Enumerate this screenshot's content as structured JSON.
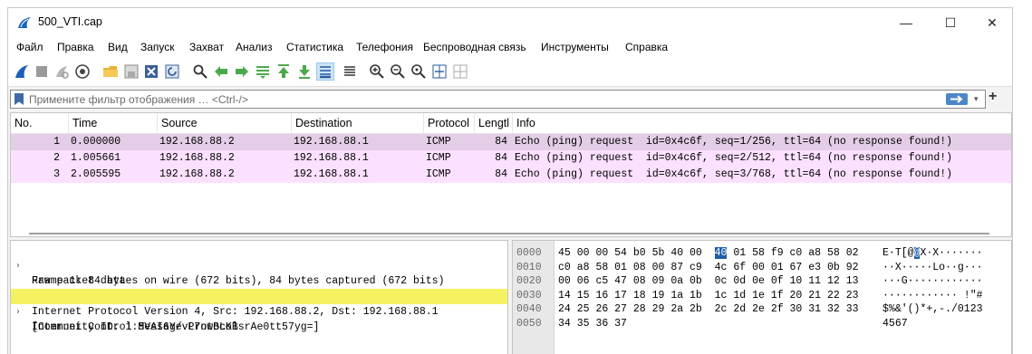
{
  "window": {
    "title": "500_VTI.cap",
    "minimize_glyph": "—",
    "maximize_glyph": "☐",
    "close_glyph": "✕"
  },
  "menu": [
    "Файл",
    "Правка",
    "Вид",
    "Запуск",
    "Захват",
    "Анализ",
    "Статистика",
    "Телефония",
    "Беспроводная связь",
    "Инструменты",
    "Справка"
  ],
  "toolbar": {
    "icons": [
      "shark-fin-start-icon",
      "stop-icon",
      "restart-icon",
      "capture-options-icon",
      "open-folder-icon",
      "save-file-icon",
      "close-file-icon",
      "reload-icon",
      "find-icon",
      "go-back-icon",
      "go-forward-icon",
      "go-to-packet-icon",
      "first-packet-icon",
      "last-packet-icon",
      "autoscroll-icon",
      "colorize-icon",
      "zoom-in-icon",
      "zoom-out-icon",
      "zoom-reset-icon",
      "resize-columns-icon",
      "layout-grid-icon"
    ],
    "active": [
      "autoscroll-icon"
    ]
  },
  "filter": {
    "placeholder": "Примените фильтр отображения … <Ctrl-/>",
    "value": "",
    "dropdown_glyph": "▾",
    "add_glyph": "+"
  },
  "packet_list": {
    "columns": [
      "No.",
      "Time",
      "Source",
      "Destination",
      "Protocol",
      "Lengtl",
      "Info"
    ],
    "rows": [
      {
        "no": "1",
        "time": "0.000000",
        "source": "192.168.88.2",
        "destination": "192.168.88.1",
        "protocol": "ICMP",
        "length": "84",
        "info": "Echo (ping) request  id=0x4c6f, seq=1/256, ttl=64 (no response found!)",
        "selected": true
      },
      {
        "no": "2",
        "time": "1.005661",
        "source": "192.168.88.2",
        "destination": "192.168.88.1",
        "protocol": "ICMP",
        "length": "84",
        "info": "Echo (ping) request  id=0x4c6f, seq=2/512, ttl=64 (no response found!)",
        "selected": false
      },
      {
        "no": "3",
        "time": "2.005595",
        "source": "192.168.88.2",
        "destination": "192.168.88.1",
        "protocol": "ICMP",
        "length": "84",
        "info": "Echo (ping) request  id=0x4c6f, seq=3/768, ttl=64 (no response found!)",
        "selected": false
      }
    ],
    "row_color": "#fce0ff",
    "selected_row_color": "#e4cde6"
  },
  "details": {
    "lines": [
      {
        "text": "Frame 1: 84 bytes on wire (672 bits), 84 bytes captured (672 bits)",
        "expandable": true,
        "highlighted": false
      },
      {
        "text": "Raw packet data",
        "expandable": false,
        "highlighted": false
      },
      {
        "text": "Internet Protocol Version 4, Src: 192.168.88.2, Dst: 192.168.88.1",
        "expandable": true,
        "highlighted": false
      },
      {
        "text": "Internet Control Message Protocol",
        "expandable": true,
        "highlighted": true
      },
      {
        "text": "[Community ID: 1:5VAI6Y/vL7nwBLKBsrAe0tt57yg=]",
        "expandable": false,
        "highlighted": false
      }
    ],
    "expand_glyph": "›",
    "highlight_color": "#f5f261"
  },
  "bytes": {
    "lines": [
      {
        "offset": "0000",
        "hex": [
          "45",
          "00",
          "00",
          "54",
          "b0",
          "5b",
          "40",
          "00",
          "40",
          "01",
          "58",
          "f9",
          "c0",
          "a8",
          "58",
          "02"
        ],
        "ascii": [
          "E",
          "·",
          "T",
          "[",
          "@",
          "@",
          "X",
          "·",
          "X",
          "·",
          "·",
          "·",
          "·",
          "·",
          "·",
          "·"
        ]
      },
      {
        "offset": "0010",
        "hex": [
          "c0",
          "a8",
          "58",
          "01",
          "08",
          "00",
          "87",
          "c9",
          "4c",
          "6f",
          "00",
          "01",
          "67",
          "e3",
          "0b",
          "92"
        ],
        "ascii": [
          "·",
          "·",
          "X",
          "·",
          "·",
          "·",
          "·",
          "·",
          "L",
          "o",
          "·",
          "·",
          "g",
          "·",
          "·",
          "·"
        ]
      },
      {
        "offset": "0020",
        "hex": [
          "00",
          "06",
          "c5",
          "47",
          "08",
          "09",
          "0a",
          "0b",
          "0c",
          "0d",
          "0e",
          "0f",
          "10",
          "11",
          "12",
          "13"
        ],
        "ascii": [
          "·",
          "·",
          "·",
          "G",
          "·",
          "·",
          "·",
          "·",
          "·",
          "·",
          "·",
          "·",
          "·",
          "·",
          "·",
          "·"
        ]
      },
      {
        "offset": "0030",
        "hex": [
          "14",
          "15",
          "16",
          "17",
          "18",
          "19",
          "1a",
          "1b",
          "1c",
          "1d",
          "1e",
          "1f",
          "20",
          "21",
          "22",
          "23"
        ],
        "ascii": [
          "·",
          "·",
          "·",
          "·",
          "·",
          "·",
          "·",
          "·",
          "·",
          "·",
          "·",
          "·",
          " ",
          "!",
          "\"",
          "#"
        ]
      },
      {
        "offset": "0040",
        "hex": [
          "24",
          "25",
          "26",
          "27",
          "28",
          "29",
          "2a",
          "2b",
          "2c",
          "2d",
          "2e",
          "2f",
          "30",
          "31",
          "32",
          "33"
        ],
        "ascii": [
          "$",
          "%",
          "&",
          "'",
          "(",
          ")",
          "*",
          "+",
          ",",
          "-",
          ".",
          "/",
          "0",
          "1",
          "2",
          "3"
        ]
      },
      {
        "offset": "0050",
        "hex": [
          "34",
          "35",
          "36",
          "37"
        ],
        "ascii": [
          "4",
          "5",
          "6",
          "7"
        ]
      }
    ],
    "highlighted_hex_index": 8,
    "highlighted_ascii_index": 5,
    "highlight_color": "#1e5fa8"
  }
}
